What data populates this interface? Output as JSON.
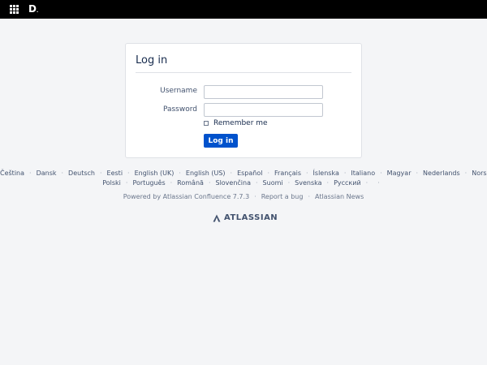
{
  "header": {
    "logo_text": "D",
    "logo_dot": ".",
    "app_switcher_icon": "grid-icon"
  },
  "login": {
    "title": "Log in",
    "username_label": "Username",
    "password_label": "Password",
    "username_value": "",
    "password_value": "",
    "remember_label": "Remember me",
    "submit_label": "Log in"
  },
  "languages_row1": [
    "Čeština",
    "Dansk",
    "Deutsch",
    "Eesti",
    "English (UK)",
    "English (US)",
    "Español",
    "Français",
    "Íslenska",
    "Italiano",
    "Magyar",
    "Nederlands",
    "Norsk"
  ],
  "languages_row2": [
    "Polski",
    "Português",
    "Română",
    "Slovenčina",
    "Suomi",
    "Svenska",
    "Русский"
  ],
  "footer": {
    "powered_by": "Powered by Atlassian Confluence 7.7.3",
    "report_bug": "Report a bug",
    "news": "Atlassian News"
  },
  "brand": {
    "name": "ATLASSIAN",
    "icon": "atlassian-logo-icon"
  },
  "colors": {
    "topbar": "#000000",
    "primary_button": "#0052cc",
    "background": "#f4f5f7"
  }
}
